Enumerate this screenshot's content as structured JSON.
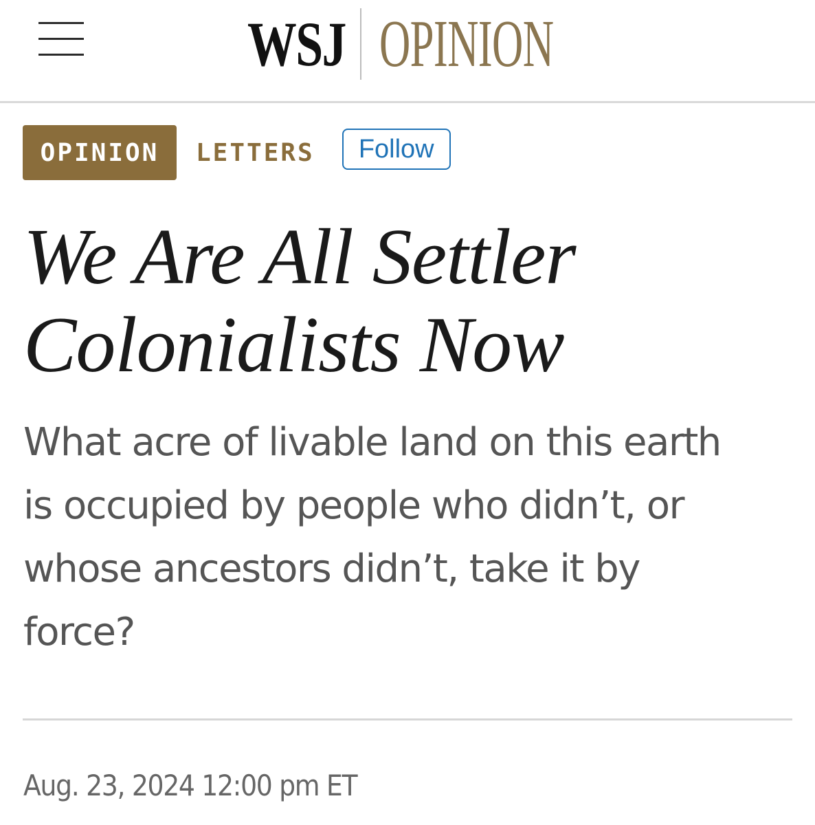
{
  "header": {
    "menu_icon": "hamburger-menu-icon",
    "logo_wsj": "WSJ",
    "logo_section": "OPINION"
  },
  "tags": {
    "badge": "OPINION",
    "section": "LETTERS",
    "follow_label": "Follow"
  },
  "article": {
    "headline_line1": "We Are All Settler",
    "headline_line2": "Colonialists Now",
    "dek_lines": [
      "What acre of livable land on this earth",
      "is occupied by people who didn’t, or",
      "whose ancestors didn’t, take it by",
      "force?"
    ],
    "timestamp": "Aug. 23, 2024 12:00 pm ET"
  },
  "colors": {
    "brand_gold": "#8a6d3b",
    "follow_blue": "#1f73b7",
    "text_dark": "#1a1a1a",
    "text_gray": "#555555"
  }
}
